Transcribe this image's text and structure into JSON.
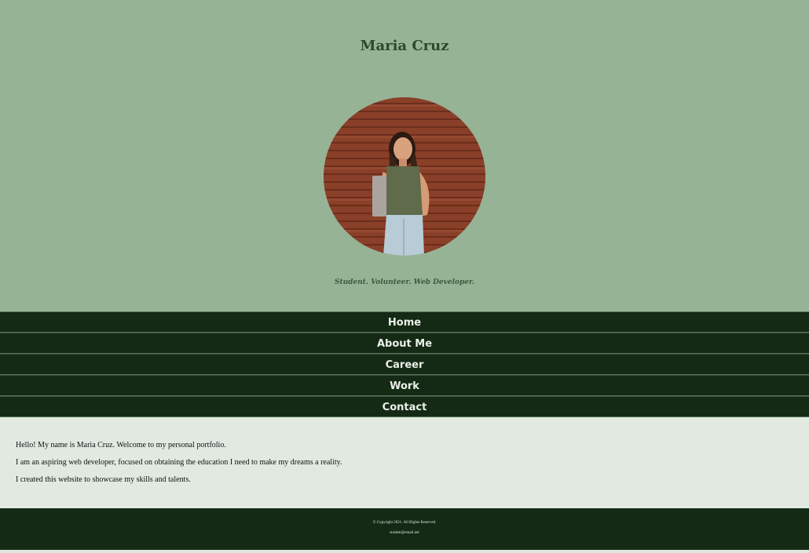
{
  "header": {
    "title": "Maria Cruz",
    "tagline": "Student. Volunteer. Web Developer."
  },
  "nav": {
    "items": [
      {
        "label": "Home"
      },
      {
        "label": "About Me"
      },
      {
        "label": "Career"
      },
      {
        "label": "Work"
      },
      {
        "label": "Contact"
      }
    ]
  },
  "main": {
    "paragraphs": [
      "Hello! My name is Maria Cruz. Welcome to my personal portfolio.",
      "I am an aspiring web developer, focused on obtaining the education I need to make my dreams a reality.",
      "I created this website to showcase my skills and talents."
    ]
  },
  "footer": {
    "copyright": "© Copyright 2021. All Rights Reserved.",
    "email": "student@email.net"
  },
  "colors": {
    "header_bg": "#96b396",
    "nav_bg": "#142a14",
    "main_bg": "#e1e9e1"
  }
}
